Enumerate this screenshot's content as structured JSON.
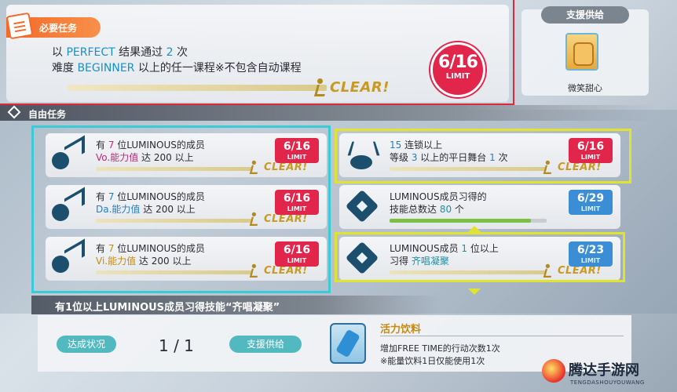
{
  "required_mission": {
    "tag": "必要任务",
    "line1": {
      "prefix": "以 ",
      "highlight1": "PERFECT",
      "mid": " 结果通过 ",
      "highlight2": "2",
      "suffix": " 次"
    },
    "line2": {
      "prefix": "难度 ",
      "highlight1": "BEGINNER",
      "suffix": " 以上的任一课程※不包含自动课程"
    },
    "clear_label": "CLEAR!",
    "limit_value": "6/16",
    "limit_label": "LIMIT"
  },
  "support_reward": {
    "title": "支援供给",
    "item_name": "微笑甜心",
    "icon": "honey-jar-icon"
  },
  "free_missions": {
    "header": "自由任务",
    "cards": [
      {
        "icon": "stat-up-icon",
        "line1_prefix": "有 ",
        "line1_hl": "7",
        "line1_suffix": " 位LUMINOUS的成员",
        "line2_hl": "Vo.能力值",
        "line2_mid": " 达 ",
        "line2_num": "200",
        "line2_suffix": " 以上",
        "limit_value": "6/16",
        "limit_label": "LIMIT",
        "clear_label": "CLEAR!"
      },
      {
        "icon": "stat-up-icon",
        "line1_prefix": "有 ",
        "line1_hl": "7",
        "line1_suffix": " 位LUMINOUS的成员",
        "line2_hl": "Da.能力值",
        "line2_mid": " 达 ",
        "line2_num": "200",
        "line2_suffix": " 以上",
        "limit_value": "6/16",
        "limit_label": "LIMIT",
        "clear_label": "CLEAR!"
      },
      {
        "icon": "stat-up-icon",
        "line1_prefix": "有 ",
        "line1_hl": "7",
        "line1_suffix": " 位LUMINOUS的成员",
        "line2_hl": "Vi.能力值",
        "line2_mid": " 达 ",
        "line2_num": "200",
        "line2_suffix": " 以上",
        "limit_value": "6/16",
        "limit_label": "LIMIT",
        "clear_label": "CLEAR!"
      },
      {
        "icon": "stage-icon",
        "line1_hl": "15",
        "line1_suffix": " 连锁以上",
        "line2_prefix": "等级 ",
        "line2_hl": "3",
        "line2_mid": " 以上的平日舞台 ",
        "line2_num": "1",
        "line2_suffix": " 次",
        "limit_value": "6/16",
        "limit_label": "LIMIT",
        "clear_label": "CLEAR!"
      },
      {
        "icon": "skill-diamond-icon",
        "line1": "LUMINOUS成员习得的",
        "line2_prefix": "技能总数达 ",
        "line2_hl": "80",
        "line2_suffix": " 个",
        "limit_value": "6/29",
        "limit_label": "LIMIT",
        "progress": 0.9
      },
      {
        "icon": "skill-diamond-icon",
        "line1_prefix": "LUMINOUS成员 ",
        "line1_hl": "1",
        "line1_suffix": " 位以上",
        "line2_prefix": "习得 ",
        "line2_hl": "齐唱凝聚",
        "limit_value": "6/23",
        "limit_label": "LIMIT",
        "clear_label": "CLEAR!"
      }
    ]
  },
  "detail": {
    "title": "有1位以上LUMINOUS成员习得技能“齐唱凝聚”",
    "status_label": "达成状况",
    "progress": "1 / 1",
    "support_label": "支援供给",
    "reward_name": "活力饮料",
    "reward_desc1": "增加FREE TIME的行动次数1次",
    "reward_desc2": "※能量饮料1日仅能使用1次"
  },
  "watermark": {
    "text": "腾达手游网",
    "sub": "TENGDASHOUYOUWANG"
  },
  "colors": {
    "limit_red": "#e2254a",
    "limit_blue": "#3b8ed6",
    "frame_cyan": "#3ccbd6",
    "frame_yellow": "#e2e330",
    "required_red": "#e0283c",
    "clear_gold": "#c99a22",
    "teal_pill": "#52b9c0"
  }
}
